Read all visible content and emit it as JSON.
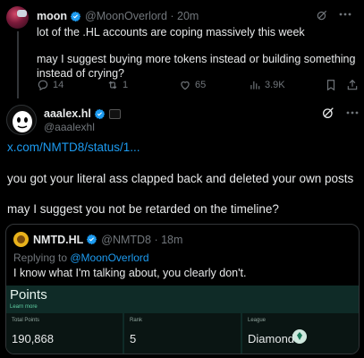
{
  "parent_post": {
    "author_name": "moon",
    "handle_time": "@MoonOverlord · 20m",
    "line1": "lot of the .HL accounts are coping massively this week",
    "line2": "may I suggest buying more tokens instead or building something instead of crying?",
    "replies": "14",
    "reposts": "1",
    "likes": "65",
    "views": "3.9K"
  },
  "main_post": {
    "author_name": "aaalex.hl",
    "handle": "@aaalexhl",
    "link": "x.com/NMTD8/status/1...",
    "paragraph1": "you got your literal ass clapped back and deleted your own posts",
    "paragraph2": "may I suggest you not be retarded on the timeline?"
  },
  "quoted_post": {
    "author_name": "NMTD.HL",
    "handle_time": "@NMTD8 · 18m",
    "replying_prefix": "Replying to ",
    "replying_handle": "@MoonOverlord",
    "text": "I know what I'm talking about, you clearly don't."
  },
  "points_card": {
    "title": "Points",
    "learn_more": "Learn more",
    "total_label": "Total Points",
    "total_value": "190,868",
    "rank_label": "Rank",
    "rank_value": "5",
    "league_label": "League",
    "league_value": "Diamond"
  },
  "colors": {
    "background": "#000000",
    "link": "#1d9bf0",
    "verified": "#1d9bf0",
    "muted": "#71767b",
    "points_bg": "#0f2b27"
  },
  "icons": [
    "reply-icon",
    "repost-icon",
    "like-icon",
    "views-icon",
    "bookmark-icon",
    "share-icon",
    "grok-icon",
    "more-icon",
    "verified-icon",
    "affiliate-badge-icon",
    "diamond-league-icon"
  ]
}
